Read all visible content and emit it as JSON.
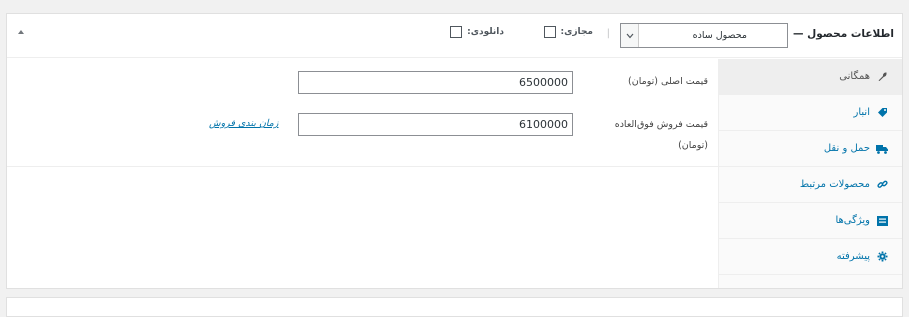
{
  "header": {
    "title": "اطلاعات محصول —",
    "product_type": "محصول ساده",
    "virtual_label": "مجازی:",
    "downloadable_label": "دانلودی:",
    "separator": "|"
  },
  "tabs": [
    {
      "label": "همگانی",
      "icon": "wrench-icon",
      "active": true
    },
    {
      "label": "انبار",
      "icon": "tag-icon",
      "active": false
    },
    {
      "label": "حمل و نقل",
      "icon": "truck-icon",
      "active": false
    },
    {
      "label": "محصولات مرتبط",
      "icon": "link-icon",
      "active": false
    },
    {
      "label": "ویژگی‌ها",
      "icon": "list-icon",
      "active": false
    },
    {
      "label": "پیشرفته",
      "icon": "gear-icon",
      "active": false
    }
  ],
  "general": {
    "regular_price_label": "قیمت اصلی (تومان)",
    "regular_price_value": "6500000",
    "sale_price_label_line1": "قیمت فروش فوق‌العاده",
    "sale_price_label_line2": "(تومان)",
    "sale_price_value": "6100000",
    "schedule_link": "زمان بندی فروش"
  },
  "colors": {
    "link": "#0073aa",
    "active_tab_bg": "#eeeeee"
  }
}
